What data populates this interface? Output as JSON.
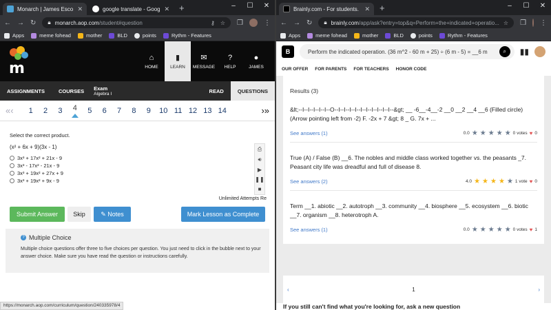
{
  "left": {
    "tabs": [
      {
        "title": "Monarch | James Escobar",
        "active": true
      },
      {
        "title": "google translate - Google Search",
        "active": false
      }
    ],
    "url_host": "monarch.aop.com",
    "url_path": "/student#question",
    "bookmarks": [
      "Apps",
      "meme fohead",
      "mother",
      "BLD",
      "points",
      "Rythm - Features"
    ],
    "nav": [
      {
        "icon": "home-icon",
        "label": "HOME"
      },
      {
        "icon": "learn-icon",
        "label": "LEARN"
      },
      {
        "icon": "message-icon",
        "label": "MESSAGE"
      },
      {
        "icon": "help-icon",
        "label": "HELP"
      },
      {
        "icon": "user-icon",
        "label": "JAMES"
      }
    ],
    "sub": {
      "assignments": "ASSIGNMENTS",
      "courses": "COURSES",
      "exam": "Exam",
      "course": "Algebra I",
      "read": "READ",
      "questions": "QUESTIONS"
    },
    "question_numbers": [
      "1",
      "2",
      "3",
      "4",
      "5",
      "6",
      "7",
      "8",
      "9",
      "10",
      "11",
      "12",
      "13",
      "14"
    ],
    "current_question": "4",
    "prompt": "Select the correct product.",
    "expression": "(x² + 6x + 9)(3x - 1)",
    "choices": [
      "3x³ + 17x² + 21x - 9",
      "3x³ - 17x² - 21x - 9",
      "3x³ + 19x² + 27x + 9",
      "3x³ + 19x² + 9x - 9"
    ],
    "attempts": "Unlimited Attempts Re",
    "buttons": {
      "submit": "Submit Answer",
      "skip": "Skip",
      "notes": "Notes",
      "mark": "Mark Lesson as Complete"
    },
    "mc_title": "Multiple Choice",
    "mc_text": "Multiple choice questions offer three to five choices per question. You just need to click in the bubble next to your answer choice. Make sure you have read the question or instructions carefully.",
    "status_url": "https://monarch.aop.com/curriculum/question/240335978/4"
  },
  "right": {
    "tab_title": "Brainly.com - For students. By st",
    "url_host": "brainly.com",
    "url_path": "/app/ask?entry=top&q=Perform+the+indicated+operatio...",
    "bookmarks": [
      "Apps",
      "meme fohead",
      "mother",
      "BLD",
      "points",
      "Rythm - Features"
    ],
    "search_query": "Perform the indicated operation.  (36 m^2 - 60 m + 25) ÷ (6 m - 5) = __6 m",
    "menu": [
      "OUR OFFER",
      "FOR PARENTS",
      "FOR TEACHERS",
      "HONOR CODE"
    ],
    "results_label": "Results (3)",
    "results": [
      {
        "text": "&lt;--I--I--I--I--I--O--I--I--I--I--I--I--I--I--I--I--&gt; __ -6__-4__-2 __0 __2 __4 __6 (Filled circle) (Arrow pointing left from -2) F. -2x + 7 &gt; 8 _ G. 7x + ...",
        "see": "See answers (1)",
        "rating": "0.0",
        "gold_stars": 0,
        "votes": "0 votes",
        "hearts": "0"
      },
      {
        "text": "True (A) / False (B) __6. The nobles and middle class worked together vs. the peasants _7. Peasant city life was dreadful and full of disease 8.",
        "see": "See answers (2)",
        "rating": "4.0",
        "gold_stars": 4,
        "votes": "1 vote",
        "hearts": "0"
      },
      {
        "text": "Term __1. abiotic __2. autotroph __3. community __4. biosphere __5. ecosystem __6. biotic __7. organism __8. heterotroph A.",
        "see": "See answers (1)",
        "rating": "0.0",
        "gold_stars": 0,
        "votes": "0 votes",
        "hearts": "1"
      }
    ],
    "page": "1",
    "notfound": "If you still can't find what you're looking for, ask a new question"
  }
}
